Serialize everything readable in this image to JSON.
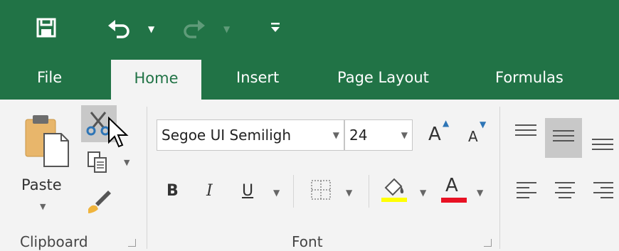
{
  "qat": {
    "save_icon": "save-icon",
    "undo_icon": "undo-icon",
    "redo_icon": "redo-icon",
    "customize_icon": "customize-qat-icon"
  },
  "tabs": {
    "file": "File",
    "home": "Home",
    "insert": "Insert",
    "page_layout": "Page Layout",
    "formulas": "Formulas"
  },
  "clipboard": {
    "paste_label": "Paste",
    "group_label": "Clipboard"
  },
  "font": {
    "font_name": "Segoe UI Semiligh",
    "font_size": "24",
    "bold": "B",
    "italic": "I",
    "underline": "U",
    "font_color_letter": "A",
    "grow_letter": "A",
    "shrink_letter": "A",
    "group_label": "Font"
  },
  "colors": {
    "brand": "#217346",
    "ribbon_bg": "#f3f3f3",
    "highlight": "#ffff00",
    "font_color": "#e81123"
  }
}
